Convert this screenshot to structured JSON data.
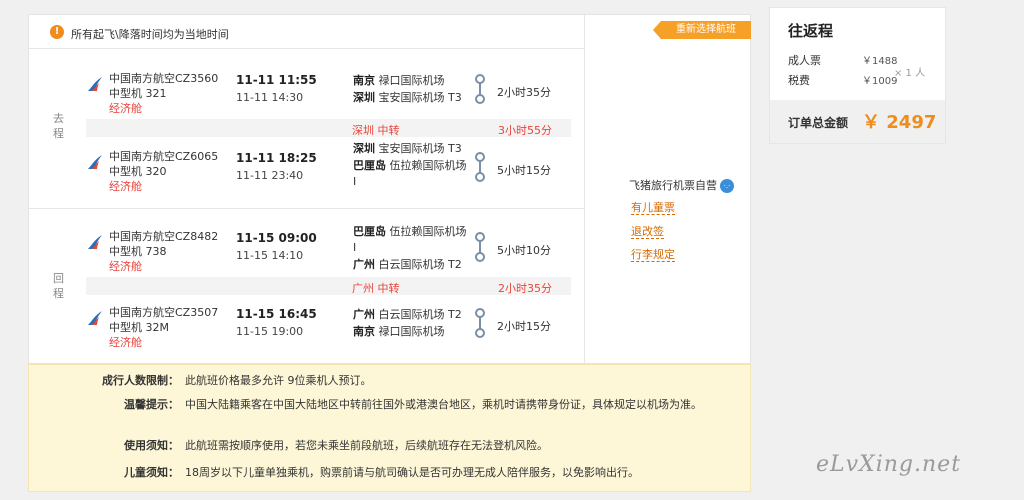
{
  "notice": "所有起飞\\降落时间均为当地时间",
  "reselect_label": "重新选择航班",
  "outbound_label": "去程",
  "return_label": "回程",
  "outbound": {
    "legs": [
      {
        "flight_no": "中国南方航空CZ3560",
        "plane": "中型机 321",
        "cabin": "经济舱",
        "dep_time": "11-11 11:55",
        "arr_time": "11-11 14:30",
        "dep_city": "南京",
        "dep_airport": "禄口国际机场",
        "arr_city": "深圳",
        "arr_airport": "宝安国际机场 T3",
        "duration": "2小时35分"
      },
      {
        "flight_no": "中国南方航空CZ6065",
        "plane": "中型机 320",
        "cabin": "经济舱",
        "dep_time": "11-11 18:25",
        "arr_time": "11-11 23:40",
        "dep_city": "深圳",
        "dep_airport": "宝安国际机场 T3",
        "arr_city": "巴厘岛",
        "arr_airport": "伍拉赖国际机场 I",
        "duration": "5小时15分"
      }
    ],
    "transfer": {
      "city": "深圳 中转",
      "duration": "3小时55分"
    }
  },
  "return": {
    "legs": [
      {
        "flight_no": "中国南方航空CZ8482",
        "plane": "中型机 738",
        "cabin": "经济舱",
        "dep_time": "11-15 09:00",
        "arr_time": "11-15 14:10",
        "dep_city": "巴厘岛",
        "dep_airport": "伍拉赖国际机场 I",
        "arr_city": "广州",
        "arr_airport": "白云国际机场 T2",
        "duration": "5小时10分"
      },
      {
        "flight_no": "中国南方航空CZ3507",
        "plane": "中型机 32M",
        "cabin": "经济舱",
        "dep_time": "11-15 16:45",
        "arr_time": "11-15 19:00",
        "dep_city": "广州",
        "dep_airport": "白云国际机场 T2",
        "arr_city": "南京",
        "arr_airport": "禄口国际机场",
        "duration": "2小时15分"
      }
    ],
    "transfer": {
      "city": "广州 中转",
      "duration": "2小时35分"
    }
  },
  "vendor": "飞猪旅行机票自营",
  "vendor_badge": "·.·",
  "links": [
    "有儿童票",
    "退改签",
    "行李规定"
  ],
  "tips": [
    {
      "label": "成行人数限制：",
      "text": "此航班价格最多允许 9位乘机人预订。"
    },
    {
      "label": "温馨提示：",
      "text": "中国大陆籍乘客在中国大陆地区中转前往国外或港澳台地区，乘机时请携带身份证，具体规定以机场为准。"
    },
    {
      "label": "使用须知：",
      "text": "此航班需按顺序使用，若您未乘坐前段航班，后续航班存在无法登机风险。"
    },
    {
      "label": "儿童须知：",
      "text": "18周岁以下儿童单独乘机，购票前请与航司确认是否可办理无成人陪伴服务，以免影响出行。"
    }
  ],
  "summary": {
    "title": "往返程",
    "adult_label": "成人票",
    "adult_price": "￥1488",
    "tax_label": "税费",
    "tax_price": "￥1009",
    "qty": "× 1 人",
    "total_label": "订单总金额",
    "total_value": "￥ 2497"
  },
  "watermark": "eLvXing.net",
  "colors": {
    "accent": "#f08c1e",
    "cabin": "#e8453c",
    "link": "#d46a00",
    "tips_bg": "#fdf7d8"
  }
}
